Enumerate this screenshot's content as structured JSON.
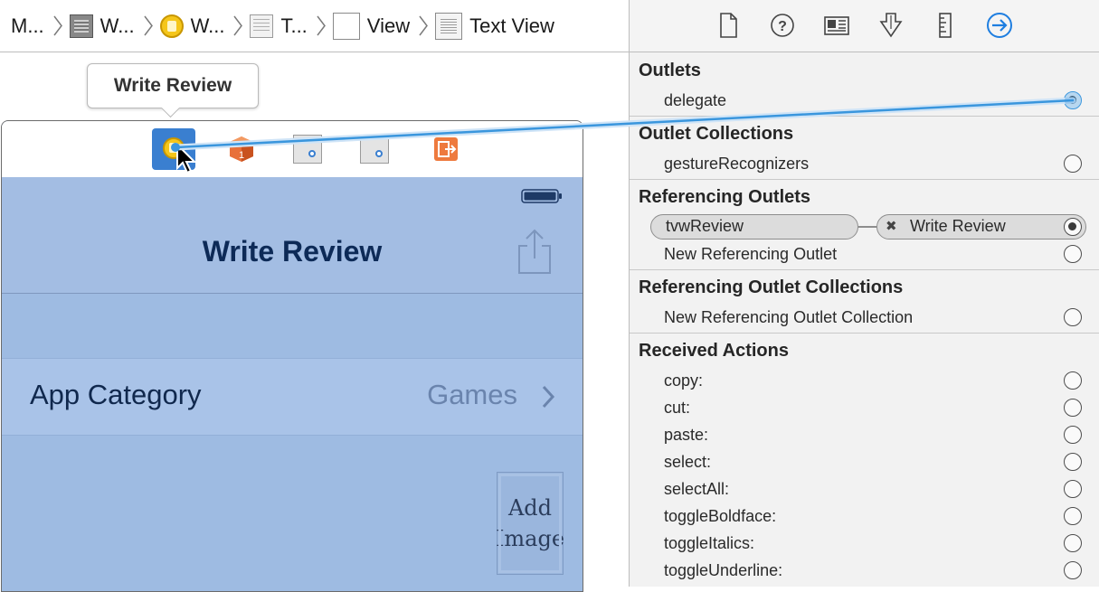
{
  "jumpbar": {
    "crumbs": [
      {
        "label": "M...",
        "icon": "storyboard-icon"
      },
      {
        "label": "W...",
        "icon": "scene-icon"
      },
      {
        "label": "W...",
        "icon": "view-controller-icon"
      },
      {
        "label": "T...",
        "icon": "table-view-icon"
      },
      {
        "label": "View",
        "icon": "view-icon"
      },
      {
        "label": "Text View",
        "icon": "text-view-icon"
      }
    ]
  },
  "canvas": {
    "tooltip": "Write Review",
    "scene": {
      "nav_title": "Write Review",
      "category_label": "App Category",
      "category_value": "Games",
      "add_image_line1": "Add",
      "add_image_line2": "Image"
    },
    "colors": {
      "connection_line": "#3a96dd",
      "selected_object": "#3a7fd0"
    }
  },
  "inspector": {
    "tabs": [
      "file-inspector-icon",
      "quick-help-icon",
      "identity-inspector-icon",
      "attributes-inspector-icon",
      "size-inspector-icon",
      "connections-inspector-icon"
    ],
    "active_tab": "connections-inspector-icon",
    "outlets": {
      "title": "Outlets",
      "items": [
        "delegate"
      ]
    },
    "outlet_collections": {
      "title": "Outlet Collections",
      "items": [
        "gestureRecognizers"
      ]
    },
    "referencing_outlets": {
      "title": "Referencing Outlets",
      "outlet_name": "tvwReview",
      "target_name": "Write Review",
      "new_item": "New Referencing Outlet"
    },
    "referencing_outlet_collections": {
      "title": "Referencing Outlet Collections",
      "items": [
        "New Referencing Outlet Collection"
      ]
    },
    "received_actions": {
      "title": "Received Actions",
      "items": [
        "copy:",
        "cut:",
        "paste:",
        "select:",
        "selectAll:",
        "toggleBoldface:",
        "toggleItalics:",
        "toggleUnderline:"
      ]
    }
  }
}
